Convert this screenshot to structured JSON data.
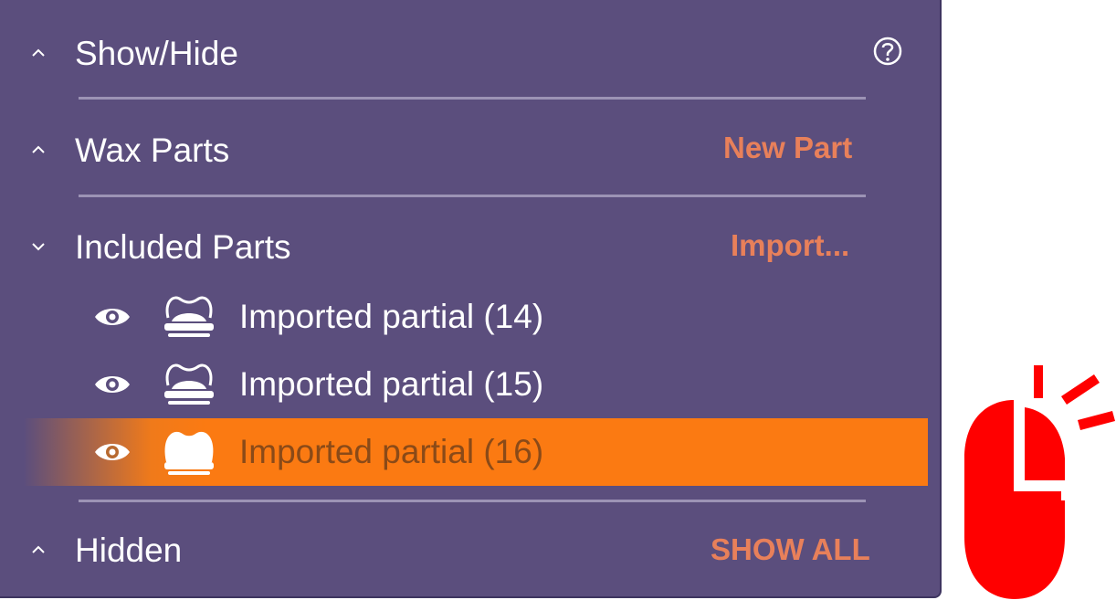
{
  "panel": {
    "show_hide": {
      "title": "Show/Hide",
      "chevron": "chevron-up",
      "help_icon": "question-circle-icon"
    },
    "wax_parts": {
      "title": "Wax Parts",
      "chevron": "chevron-up",
      "action": "New Part"
    },
    "included_parts": {
      "title": "Included Parts",
      "chevron": "chevron-down",
      "action": "Import...",
      "items": [
        {
          "label": "Imported partial (14)",
          "visible_icon": "eye-icon",
          "type_icon": "tooth-outline-icon",
          "selected": false
        },
        {
          "label": "Imported partial (15)",
          "visible_icon": "eye-icon",
          "type_icon": "tooth-outline-icon",
          "selected": false
        },
        {
          "label": "Imported partial (16)",
          "visible_icon": "eye-icon",
          "type_icon": "tooth-filled-icon",
          "selected": true
        }
      ]
    },
    "hidden": {
      "title": "Hidden",
      "chevron": "chevron-up",
      "action": "SHOW ALL"
    }
  },
  "overlay": {
    "mouse_icon": "mouse-click-icon"
  },
  "colors": {
    "panel_bg": "#5b4e7d",
    "accent_link": "#e8805a",
    "selected_row": "#fb7a12",
    "mouse_red": "#ff0000"
  }
}
